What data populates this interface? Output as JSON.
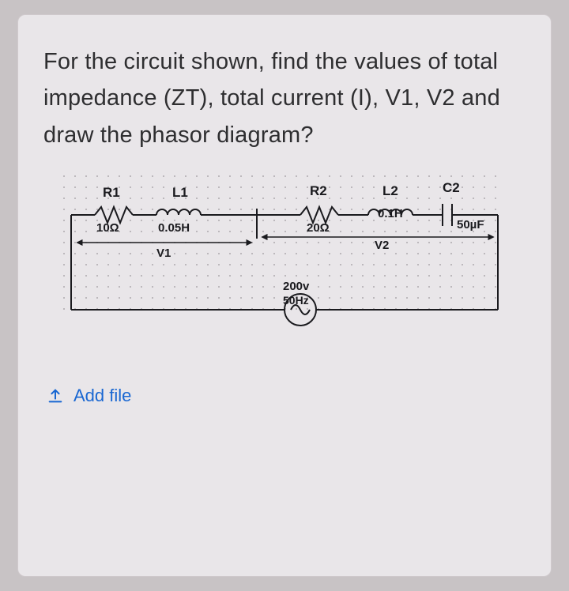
{
  "question": "For the circuit shown, find the values of total impedance (ZT), total current (I), V1, V2 and draw the phasor diagram?",
  "components": {
    "R1": {
      "label": "R1",
      "value": "10Ω"
    },
    "L1": {
      "label": "L1",
      "value": "0.05H"
    },
    "R2": {
      "label": "R2",
      "value": "20Ω"
    },
    "L2": {
      "label": "L2",
      "value": "0.1H"
    },
    "C2": {
      "label": "C2",
      "value": "50µF"
    }
  },
  "sections": {
    "V1": "V1",
    "V2": "V2"
  },
  "source": {
    "voltage": "200v",
    "frequency": "50Hz"
  },
  "addFile": {
    "label": "Add file"
  }
}
